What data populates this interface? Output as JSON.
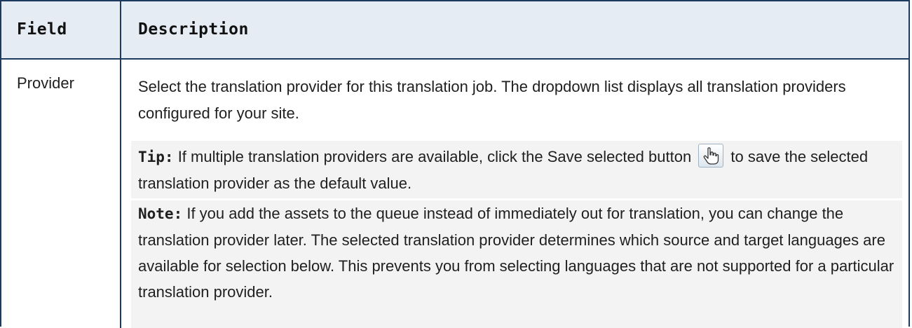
{
  "table": {
    "headers": {
      "field": "Field",
      "description": "Description"
    },
    "rows": [
      {
        "field": "Provider",
        "description": "Select the translation provider for this translation job. The dropdown list displays all translation providers configured for your site.",
        "tip": {
          "label": "Tip:",
          "text_before_icon": " If multiple translation providers are available, click the Save selected button ",
          "icon": "hand-pointer-icon",
          "text_after_icon": " to save the selected translation provider as the default value."
        },
        "note": {
          "label": "Note:",
          "text": " If you add the assets to the queue instead of immediately out for translation, you can change the translation provider later. The selected translation provider determines which source and target languages are available for selection below. This prevents you from selecting languages that are not supported for a particular translation provider."
        }
      }
    ]
  },
  "colors": {
    "border": "#1d3a5f",
    "header_bg": "#e6ecf3",
    "callout_bg": "#f3f3f3"
  }
}
